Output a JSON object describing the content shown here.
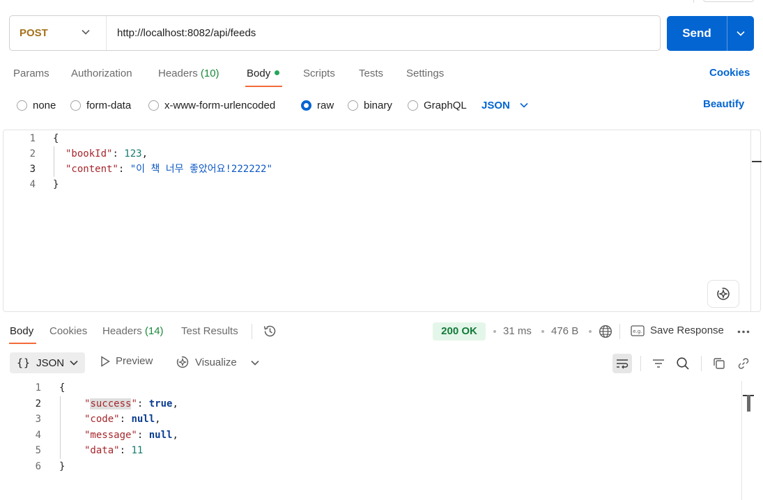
{
  "request": {
    "method": "POST",
    "url": "http://localhost:8082/api/feeds",
    "send_label": "Send",
    "tabs": [
      {
        "label": "Params"
      },
      {
        "label": "Authorization"
      },
      {
        "label": "Headers",
        "count": "(10)"
      },
      {
        "label": "Body"
      },
      {
        "label": "Scripts"
      },
      {
        "label": "Tests"
      },
      {
        "label": "Settings"
      }
    ],
    "cookies_label": "Cookies",
    "body_types": [
      "none",
      "form-data",
      "x-www-form-urlencoded",
      "raw",
      "binary",
      "GraphQL"
    ],
    "selected_body_type": "raw",
    "format": "JSON",
    "beautify_label": "Beautify",
    "body_lines": [
      "1",
      "2",
      "3",
      "4"
    ],
    "body": {
      "open": "{",
      "key1": "\"bookId\"",
      "val1": "123",
      "key2": "\"content\"",
      "val2": "\"이 책 너무 좋았어요!222222\"",
      "close": "}"
    }
  },
  "response": {
    "tabs": [
      {
        "label": "Body"
      },
      {
        "label": "Cookies"
      },
      {
        "label": "Headers",
        "count": "(14)"
      },
      {
        "label": "Test Results"
      }
    ],
    "status": "200 OK",
    "time": "31 ms",
    "size": "476 B",
    "save_label": "Save Response",
    "format_label": "JSON",
    "preview_label": "Preview",
    "visualize_label": "Visualize",
    "lines": [
      "1",
      "2",
      "3",
      "4",
      "5",
      "6"
    ],
    "body": {
      "open": "{",
      "k_success": "success",
      "v_success": "true",
      "k_code": "\"code\"",
      "v_code": "null",
      "k_message": "\"message\"",
      "v_message": "null",
      "k_data": "\"data\"",
      "v_data": "11",
      "close": "}"
    }
  },
  "colors": {
    "accent": "#0265d2",
    "method": "#a4711a",
    "active_tab": "#f26b3a",
    "status_ok": "#137a3a"
  }
}
